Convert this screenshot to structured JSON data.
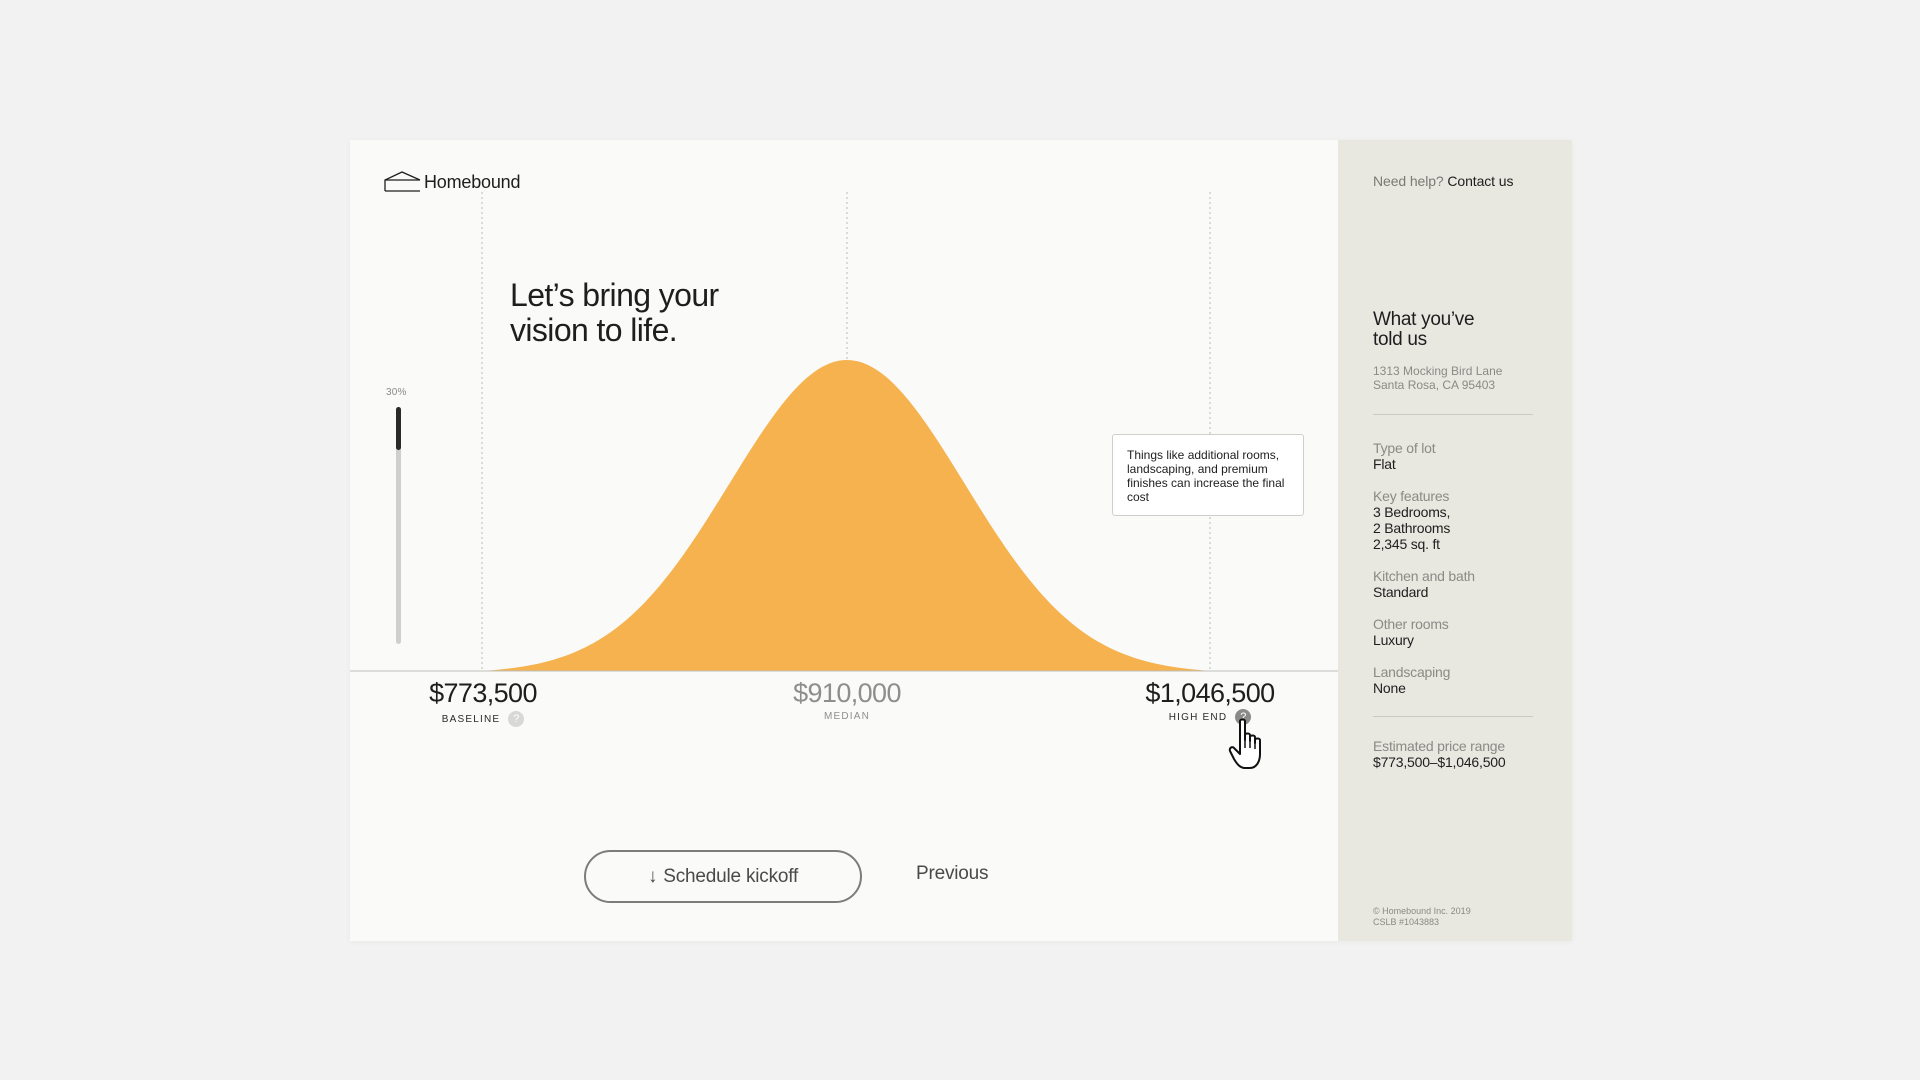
{
  "brand": {
    "name": "Homebound"
  },
  "headline": {
    "line1": "Let’s bring your",
    "line2": "vision to life."
  },
  "slider": {
    "label": "30%",
    "value_percent": 30
  },
  "chart_data": {
    "type": "area",
    "distribution": "bell curve",
    "x_markers": [
      773500,
      910000,
      1046500
    ],
    "title": "",
    "xlabel": "",
    "ylabel": "",
    "color": "#f5b24e"
  },
  "prices": {
    "baseline": {
      "value": "$773,500",
      "label": "BASELINE",
      "help": "?"
    },
    "median": {
      "value": "$910,000",
      "label": "MEDIAN"
    },
    "high_end": {
      "value": "$1,046,500",
      "label": "HIGH END",
      "help": "?"
    }
  },
  "tooltip": {
    "text": "Things like additional rooms, landscaping, and premium finishes can increase the final cost"
  },
  "actions": {
    "schedule_label": "Schedule kickoff",
    "schedule_icon": "↓",
    "previous_label": "Previous"
  },
  "sidebar": {
    "help_prefix": "Need help?",
    "contact_label": "Contact us",
    "title_line1": "What you’ve",
    "title_line2": "told us",
    "address_line1": "1313 Mocking Bird Lane",
    "address_line2": "Santa Rosa, CA 95403",
    "fields": [
      {
        "label": "Type of lot",
        "value": [
          "Flat"
        ]
      },
      {
        "label": "Key features",
        "value": [
          "3 Bedrooms,",
          "2 Bathrooms",
          "2,345 sq. ft"
        ]
      },
      {
        "label": "Kitchen and bath",
        "value": [
          "Standard"
        ]
      },
      {
        "label": "Other rooms",
        "value": [
          "Luxury"
        ]
      },
      {
        "label": "Landscaping",
        "value": [
          "None"
        ]
      }
    ],
    "estimate_label": "Estimated price range",
    "estimate_value": "$773,500–$1,046,500",
    "footer_line1": "© Homebound Inc. 2019",
    "footer_line2": "CSLB #1043883"
  },
  "colors": {
    "curve": "#f5b24e",
    "sidebar_bg": "#e8e7e0",
    "page_bg": "#f1f2f1"
  },
  "icons": {
    "logo": "house-outline-icon",
    "cursor": "pointer-hand-icon",
    "arrow": "arrow-down-icon"
  }
}
